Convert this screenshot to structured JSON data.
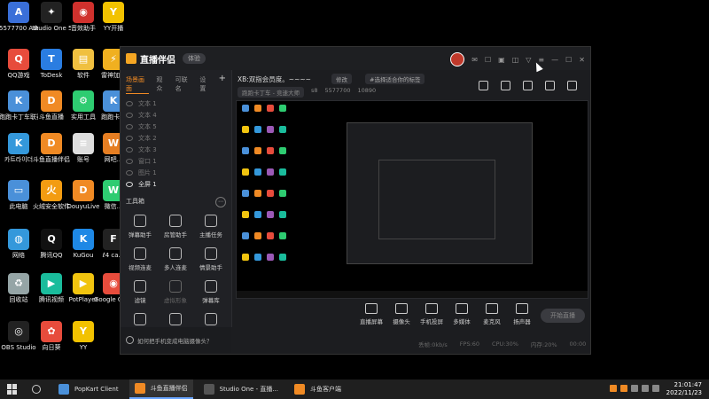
{
  "desktop_icons": [
    {
      "label": "5577700 Administr...",
      "color": "#3a6fd8",
      "glyph": "A"
    },
    {
      "label": "Studio One 5",
      "color": "#222",
      "glyph": "✦"
    },
    {
      "label": "音效助手",
      "color": "#d0312d",
      "glyph": "◉"
    },
    {
      "label": "YY开播",
      "color": "#f2c200",
      "glyph": "Y"
    },
    {
      "label": "QQ游戏",
      "color": "#e74c3c",
      "glyph": "Q"
    },
    {
      "label": "ToDesk",
      "color": "#2a7de1",
      "glyph": "T"
    },
    {
      "label": "软件",
      "color": "#f0c040",
      "glyph": "▤"
    },
    {
      "label": "雷神加...",
      "color": "#f0b020",
      "glyph": "⚡"
    },
    {
      "label": "跑跑卡丁车联赛版",
      "color": "#4a90d9",
      "glyph": "K"
    },
    {
      "label": "斗鱼直播",
      "color": "#f08a24",
      "glyph": "D"
    },
    {
      "label": "实用工具",
      "color": "#2ecc71",
      "glyph": "⚙"
    },
    {
      "label": "跑跑卡...",
      "color": "#4a90d9",
      "glyph": "K"
    },
    {
      "label": "카트라이더",
      "color": "#3498db",
      "glyph": "K"
    },
    {
      "label": "斗鱼直播伴侣",
      "color": "#f08a24",
      "glyph": "D"
    },
    {
      "label": "账号",
      "color": "#ddd",
      "glyph": "≡"
    },
    {
      "label": "网吧...",
      "color": "#e67e22",
      "glyph": "W"
    },
    {
      "label": "此电脑",
      "color": "#4a90d9",
      "glyph": "▭"
    },
    {
      "label": "火绒安全软件",
      "color": "#f39c12",
      "glyph": "火"
    },
    {
      "label": "DouyuLive",
      "color": "#f08a24",
      "glyph": "D"
    },
    {
      "label": "微信...",
      "color": "#2ecc71",
      "glyph": "W"
    },
    {
      "label": "网络",
      "color": "#3498db",
      "glyph": "◍"
    },
    {
      "label": "腾讯QQ",
      "color": "#111",
      "glyph": "Q"
    },
    {
      "label": "KuGou",
      "color": "#1e88e5",
      "glyph": "K"
    },
    {
      "label": "ℓ4 ca...",
      "color": "#222",
      "glyph": "F"
    },
    {
      "label": "回收站",
      "color": "#95a5a6",
      "glyph": "♻"
    },
    {
      "label": "腾讯视频",
      "color": "#1abc9c",
      "glyph": "▶"
    },
    {
      "label": "PotPlayer",
      "color": "#f1c40f",
      "glyph": "▶"
    },
    {
      "label": "Google Chrome",
      "color": "#e74c3c",
      "glyph": "◉"
    },
    {
      "label": "OBS Studio",
      "color": "#222",
      "glyph": "◎"
    },
    {
      "label": "向日葵",
      "color": "#e74c3c",
      "glyph": "✿"
    },
    {
      "label": "YY",
      "color": "#f2c200",
      "glyph": "Y"
    }
  ],
  "app": {
    "name": "直播伴侣",
    "badge": "体验",
    "tabs": [
      "场景画面",
      "观众",
      "可联名",
      "设置"
    ],
    "active_tab": "场景画面",
    "layers": [
      "文本 1",
      "文本 4",
      "文本 5",
      "文本 2",
      "文本 3",
      "窗口 1",
      "图片 1",
      "全屏 1"
    ],
    "toolbox_title": "工具箱",
    "tools": [
      {
        "label": "弹幕助手",
        "dim": false
      },
      {
        "label": "房管助手",
        "dim": false
      },
      {
        "label": "主播任务",
        "dim": false
      },
      {
        "label": "视频连麦",
        "dim": false
      },
      {
        "label": "多人连麦",
        "dim": false
      },
      {
        "label": "情景助手",
        "dim": false
      },
      {
        "label": "滤镜",
        "dim": false
      },
      {
        "label": "虚拟形象",
        "dim": true
      },
      {
        "label": "弹幕库",
        "dim": false
      },
      {
        "label": "",
        "dim": false
      },
      {
        "label": "",
        "dim": false
      },
      {
        "label": "",
        "dim": false
      }
    ],
    "help_text": "如何把手机变成电脑摄像头？",
    "room_title": "XB:双指会员度。~~~~",
    "edit_label": "修改",
    "category_pill": "#选择适合你的标签",
    "game_label": "跑跑卡丁车 - 竞速大师",
    "room_id": "5577700",
    "level": "s8",
    "hot_value": "10890",
    "bottom_buttons": [
      "直播屏幕",
      "摄像头",
      "手机投屏",
      "多媒体",
      "麦克风",
      "扬声器"
    ],
    "start_label": "开始直播",
    "status": [
      "丢帧:0kb/s",
      "FPS:60",
      "CPU:30%",
      "内存:20%",
      "00:00"
    ]
  },
  "taskbar": {
    "apps": [
      {
        "label": "PopKart Client",
        "color": "#4a90d9",
        "active": false
      },
      {
        "label": "斗鱼直播伴侣",
        "color": "#f08a24",
        "active": true
      },
      {
        "label": "Studio One - 直播...",
        "color": "#555",
        "active": false
      },
      {
        "label": "斗鱼客户端",
        "color": "#f08a24",
        "active": false
      }
    ],
    "time": "21:01:47",
    "date": "2022/11/23"
  }
}
